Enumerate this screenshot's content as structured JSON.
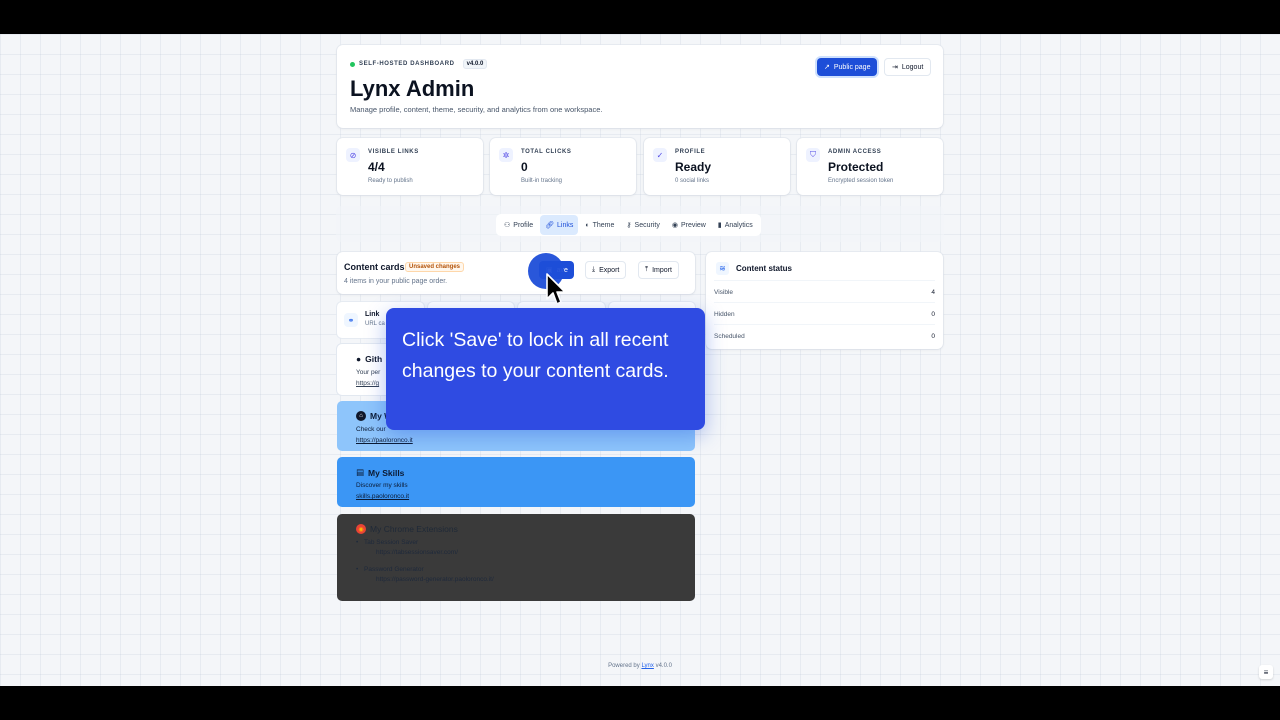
{
  "header": {
    "eyebrow": "SELF-HOSTED DASHBOARD",
    "version": "v4.0.0",
    "title": "Lynx Admin",
    "subtitle": "Manage profile, content, theme, security, and analytics from one workspace.",
    "public_page_label": "Public page",
    "logout_label": "Logout"
  },
  "stats": [
    {
      "label": "VISIBLE LINKS",
      "value": "4/4",
      "sub": "Ready to publish",
      "icon": "eye-off-icon"
    },
    {
      "label": "TOTAL CLICKS",
      "value": "0",
      "sub": "Built-in tracking",
      "icon": "cursor-click-icon"
    },
    {
      "label": "PROFILE",
      "value": "Ready",
      "sub": "0 social links",
      "icon": "check-circle-icon"
    },
    {
      "label": "ADMIN ACCESS",
      "value": "Protected",
      "sub": "Encrypted session token",
      "icon": "shield-icon"
    }
  ],
  "tabs": [
    {
      "label": "Profile",
      "icon": "user-icon"
    },
    {
      "label": "Links",
      "icon": "link-icon",
      "active": true
    },
    {
      "label": "Theme",
      "icon": "palette-icon"
    },
    {
      "label": "Security",
      "icon": "key-icon"
    },
    {
      "label": "Preview",
      "icon": "eye-icon"
    },
    {
      "label": "Analytics",
      "icon": "bar-chart-icon"
    }
  ],
  "content_cards": {
    "title": "Content cards",
    "badge": "Unsaved changes",
    "subtitle": "4 items in your public page order.",
    "save_label": "ave",
    "export_label": "Export",
    "import_label": "Import"
  },
  "add_types": [
    {
      "label": "Link",
      "sub": "URL ca"
    },
    {
      "label": "",
      "sub": ""
    },
    {
      "label": "",
      "sub": ""
    },
    {
      "label": "",
      "sub": ""
    }
  ],
  "links": [
    {
      "title": "Gith",
      "desc": "Your per",
      "url": "https://g",
      "icon": "github-icon",
      "bg": "#ffffff"
    },
    {
      "title": "My W",
      "desc": "Check our",
      "url": "https://paoloronco.it",
      "icon": "home-icon",
      "bg": "#8ec5fb"
    },
    {
      "title": "My Skills",
      "desc": "Discover my skills",
      "url": "skills.paoloronco.it",
      "icon": "code-window-icon",
      "bg": "#3b96f5"
    },
    {
      "title": "My Chrome Extensions",
      "icon": "chrome-icon",
      "bg": "#3a3a3a",
      "items": [
        {
          "title": "Tab Session Saver",
          "url": "https://tabsessionsaver.com/"
        },
        {
          "title": "Password Generator",
          "url": "https://password-generator.paoloronco.it/"
        }
      ]
    }
  ],
  "content_status": {
    "title": "Content status",
    "rows": [
      {
        "label": "Visible",
        "value": "4"
      },
      {
        "label": "Hidden",
        "value": "0"
      },
      {
        "label": "Scheduled",
        "value": "0"
      }
    ]
  },
  "tooltip": {
    "text": "Click 'Save' to lock in all recent changes to your content cards."
  },
  "footer": {
    "prefix": "Powered by",
    "brand": "Lynx",
    "version": "v4.0.0"
  },
  "colors": {
    "accent": "#1d4ed8",
    "tooltip_bg": "#2f4be2",
    "warn": "#b45309"
  }
}
